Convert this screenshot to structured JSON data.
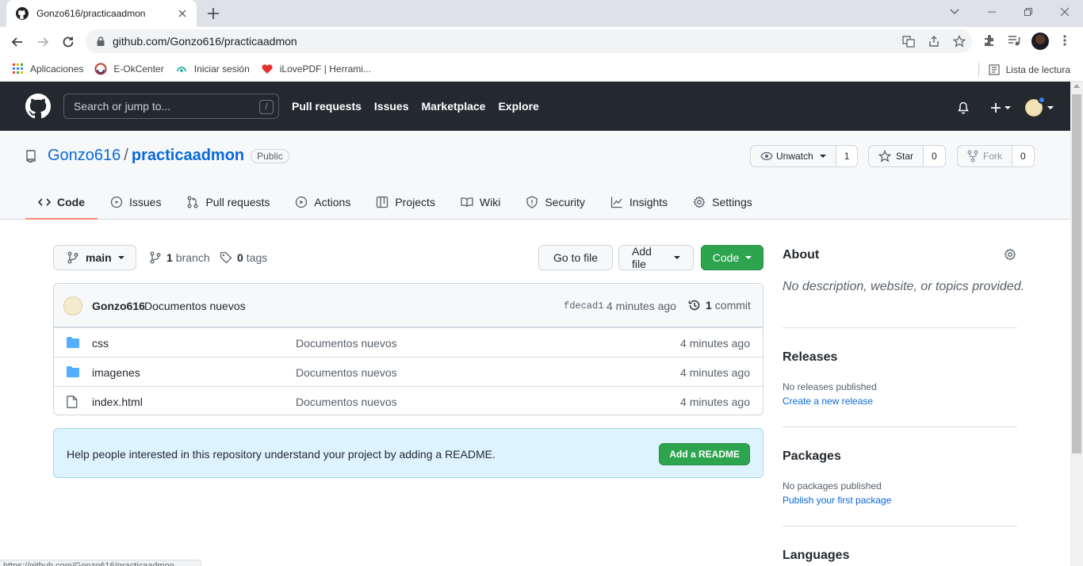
{
  "browser": {
    "tab_title": "Gonzo616/practicaadmon",
    "url": "github.com/Gonzo616/practicaadmon",
    "bookmarks": [
      "Aplicaciones",
      "E-OkCenter",
      "Iniciar sesión",
      "iLovePDF | Herrami..."
    ],
    "reading_list": "Lista de lectura",
    "status_url": "https://github.com/Gonzo616/practicaadmon"
  },
  "gh": {
    "search_placeholder": "Search or jump to...",
    "search_key": "/",
    "nav": [
      "Pull requests",
      "Issues",
      "Marketplace",
      "Explore"
    ]
  },
  "repo": {
    "owner": "Gonzo616",
    "separator": "/",
    "name": "practicaadmon",
    "visibility": "Public",
    "watch_label": "Unwatch",
    "watch_count": "1",
    "star_label": "Star",
    "star_count": "0",
    "fork_label": "Fork",
    "fork_count": "0",
    "tabs": [
      "Code",
      "Issues",
      "Pull requests",
      "Actions",
      "Projects",
      "Wiki",
      "Security",
      "Insights",
      "Settings"
    ],
    "selected_tab": "Code"
  },
  "code": {
    "branch": "main",
    "branch_count": "1",
    "branch_word": "branch",
    "tag_count": "0",
    "tag_word": "tags",
    "go_to_file": "Go to file",
    "add_file": "Add file",
    "code_button": "Code",
    "commit": {
      "author": "Gonzo616",
      "message": "Documentos nuevos",
      "sha": "fdecad1",
      "time": "4 minutes ago",
      "count": "1",
      "count_word": "commit"
    },
    "files": [
      {
        "name": "css",
        "type": "folder",
        "message": "Documentos nuevos",
        "age": "4 minutes ago"
      },
      {
        "name": "imagenes",
        "type": "folder",
        "message": "Documentos nuevos",
        "age": "4 minutes ago"
      },
      {
        "name": "index.html",
        "type": "file",
        "message": "Documentos nuevos",
        "age": "4 minutes ago"
      }
    ],
    "readme_hint": "Help people interested in this repository understand your project by adding a README.",
    "readme_button": "Add a README"
  },
  "sidebar": {
    "about_title": "About",
    "about_desc": "No description, website, or topics provided.",
    "releases_title": "Releases",
    "releases_text": "No releases published",
    "releases_link": "Create a new release",
    "packages_title": "Packages",
    "packages_text": "No packages published",
    "packages_link": "Publish your first package",
    "languages_title": "Languages"
  },
  "colors": {
    "header_bg": "#24292f",
    "link": "#0969da",
    "green": "#2da44e",
    "tab_underline": "#fd8c73",
    "folder": "#54aeff"
  }
}
